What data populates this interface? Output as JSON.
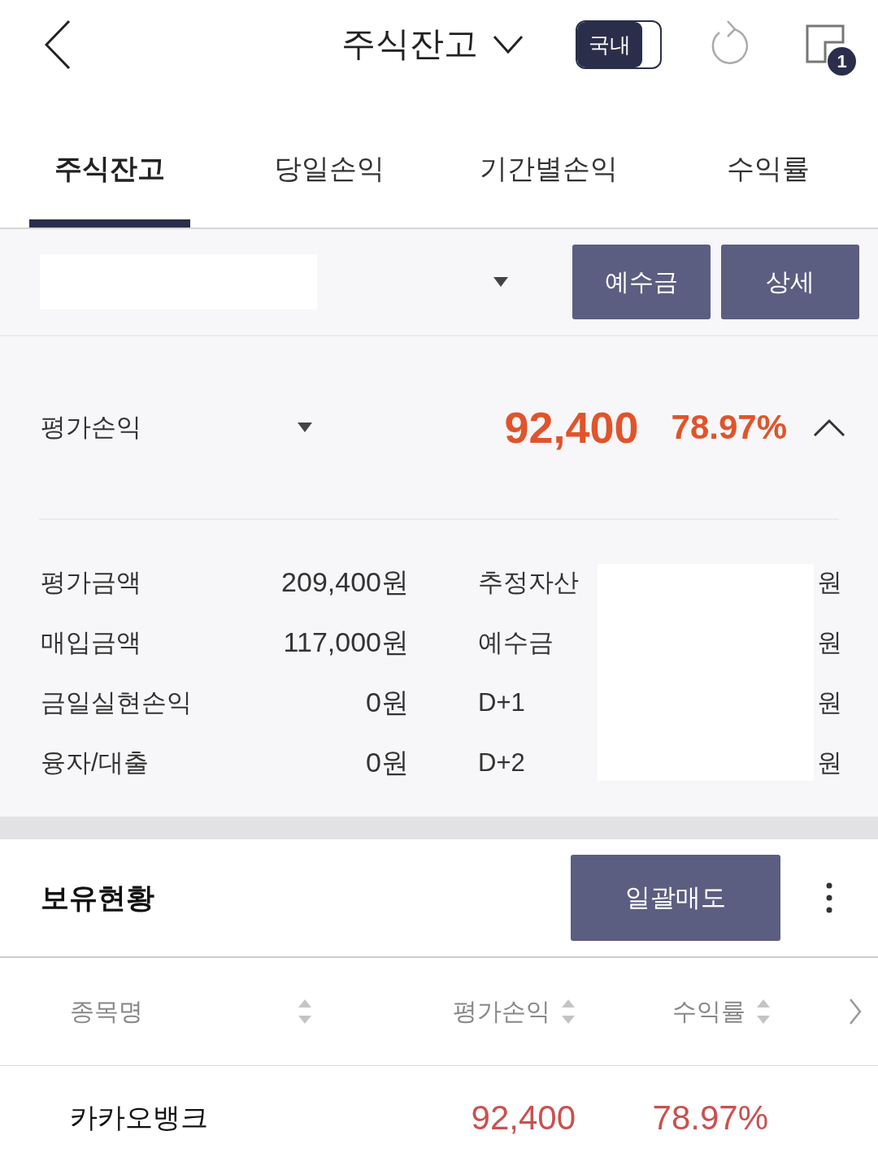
{
  "header": {
    "title": "주식잔고",
    "market_toggle": {
      "label": "국내",
      "on": true
    },
    "badge": "1"
  },
  "tabs": [
    {
      "label": "주식잔고",
      "selected": true
    },
    {
      "label": "당일손익",
      "selected": false
    },
    {
      "label": "기간별손익",
      "selected": false
    },
    {
      "label": "수익률",
      "selected": false
    }
  ],
  "account_bar": {
    "buttons": [
      "예수금",
      "상세"
    ]
  },
  "summary": {
    "metric": {
      "label": "평가손익",
      "value": "92,400",
      "rate": "78.97%",
      "expanded": true
    },
    "left_items": [
      {
        "label": "평가금액",
        "value": "209,400원"
      },
      {
        "label": "매입금액",
        "value": "117,000원"
      },
      {
        "label": "금일실현손익",
        "value": "0원"
      },
      {
        "label": "융자/대출",
        "value": "0원"
      }
    ],
    "right_items": [
      {
        "label": "추정자산",
        "unit": "원"
      },
      {
        "label": "예수금",
        "unit": "원"
      },
      {
        "label": "D+1",
        "unit": "원"
      },
      {
        "label": "D+2",
        "unit": "원"
      }
    ]
  },
  "holdings": {
    "title": "보유현황",
    "sell_all_button": "일괄매도",
    "columns": [
      {
        "label": "종목명"
      },
      {
        "label": "평가손익"
      },
      {
        "label": "수익률"
      }
    ],
    "rows": [
      {
        "name": "카카오뱅크",
        "profit": "92,400",
        "rate": "78.97%"
      }
    ]
  }
}
